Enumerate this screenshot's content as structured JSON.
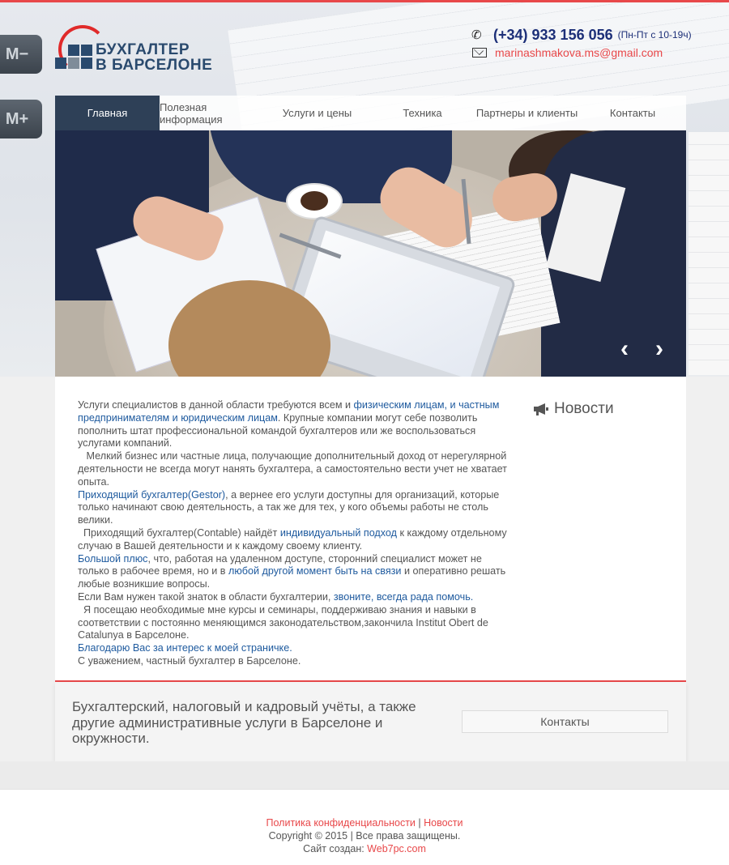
{
  "logo": {
    "line1": "БУХГАЛТЕР",
    "line2": "В БАРСЕЛОНЕ"
  },
  "contacts": {
    "phone": "(+34) 933 156 056",
    "hours": "(Пн-Пт с 10-19ч)",
    "email": "marinashmakova.ms@gmail.com"
  },
  "background": {
    "keys": [
      "M−",
      "M+"
    ]
  },
  "nav": {
    "items": [
      {
        "label": "Главная",
        "active": true
      },
      {
        "label": "Полезная информация"
      },
      {
        "label": "Услуги и цены"
      },
      {
        "label": "Техника"
      },
      {
        "label": "Партнеры и клиенты"
      },
      {
        "label": "Контакты"
      }
    ]
  },
  "slider": {
    "prev_icon": "chevron-left-icon",
    "next_icon": "chevron-right-icon",
    "prev": "‹",
    "next": "›"
  },
  "main": {
    "p1_a": "Услуги специалистов в данной области требуются всем и ",
    "p1_link": "физическим лицам, и частным предпринимателям и юридическим лицам",
    "p1_b": ". Крупные компании могут себе позволить пополнить штат профессиональной командой бухгалтеров или же воспользоваться услугами компаний.",
    "p2": "   Мелкий бизнес или частные лица, получающие дополнительный доход от нерегулярной деятельности не всегда могут нанять бухгалтера, а самостоятельно вести учет не хватает опыта.",
    "p3_link": "Приходящий бухгалтер(Gestor)",
    "p3_b": ", а вернее его услуги доступны для организаций, которые только начинают свою деятельность, а так же для тех, у кого объемы работы не столь велики.",
    "p4_a": "  Приходящий бухгалтер(Contable) найдёт ",
    "p4_link": "индивидуальный подход",
    "p4_b": " к каждому отдельному случаю в Вашей деятельности и к каждому своему клиенту.",
    "p5_link": "Большой плюс",
    "p5_b": ", что, работая на удаленном доступе, сторонний специалист может не только в рабочее время, но и в ",
    "p5_link2": "любой другой момент быть на связи",
    "p5_c": " и оперативно решать любые возникшие вопросы.",
    "p6_a": "Если Вам нужен такой знаток в области бухгалтерии, ",
    "p6_link": "звоните, всегда рада помочь.",
    "p7": "  Я посещаю необходимые мне курсы и семинары, поддерживаю знания и навыки в соответствии с постоянно меняющимся законодательством,закончила Institut Obert de Catalunya в Барселоне.",
    "p8_link": "Благодарю Вас за интерес к моей страничке.",
    "p9": "С уважением, частный бухгалтер в Барселоне."
  },
  "sidebar": {
    "news_title": "Новости",
    "news_icon": "megaphone-icon"
  },
  "cta": {
    "text": "Бухгалтерский, налоговый и кадровый учёты, а также другие административные услуги в Барселоне и окружности.",
    "button": "Контакты"
  },
  "footer": {
    "privacy": "Политика конфиденциальности",
    "sep": " | ",
    "news": "Новости",
    "copyright": "Copyright © 2015 | Все права защищены.",
    "made_by_label": "Сайт создан: ",
    "made_by_link": "Web7pc.com"
  },
  "colors": {
    "accent": "#e8484a",
    "nav_active": "#2e4057",
    "link": "#1e5a9e",
    "phone": "#1c2f78"
  }
}
